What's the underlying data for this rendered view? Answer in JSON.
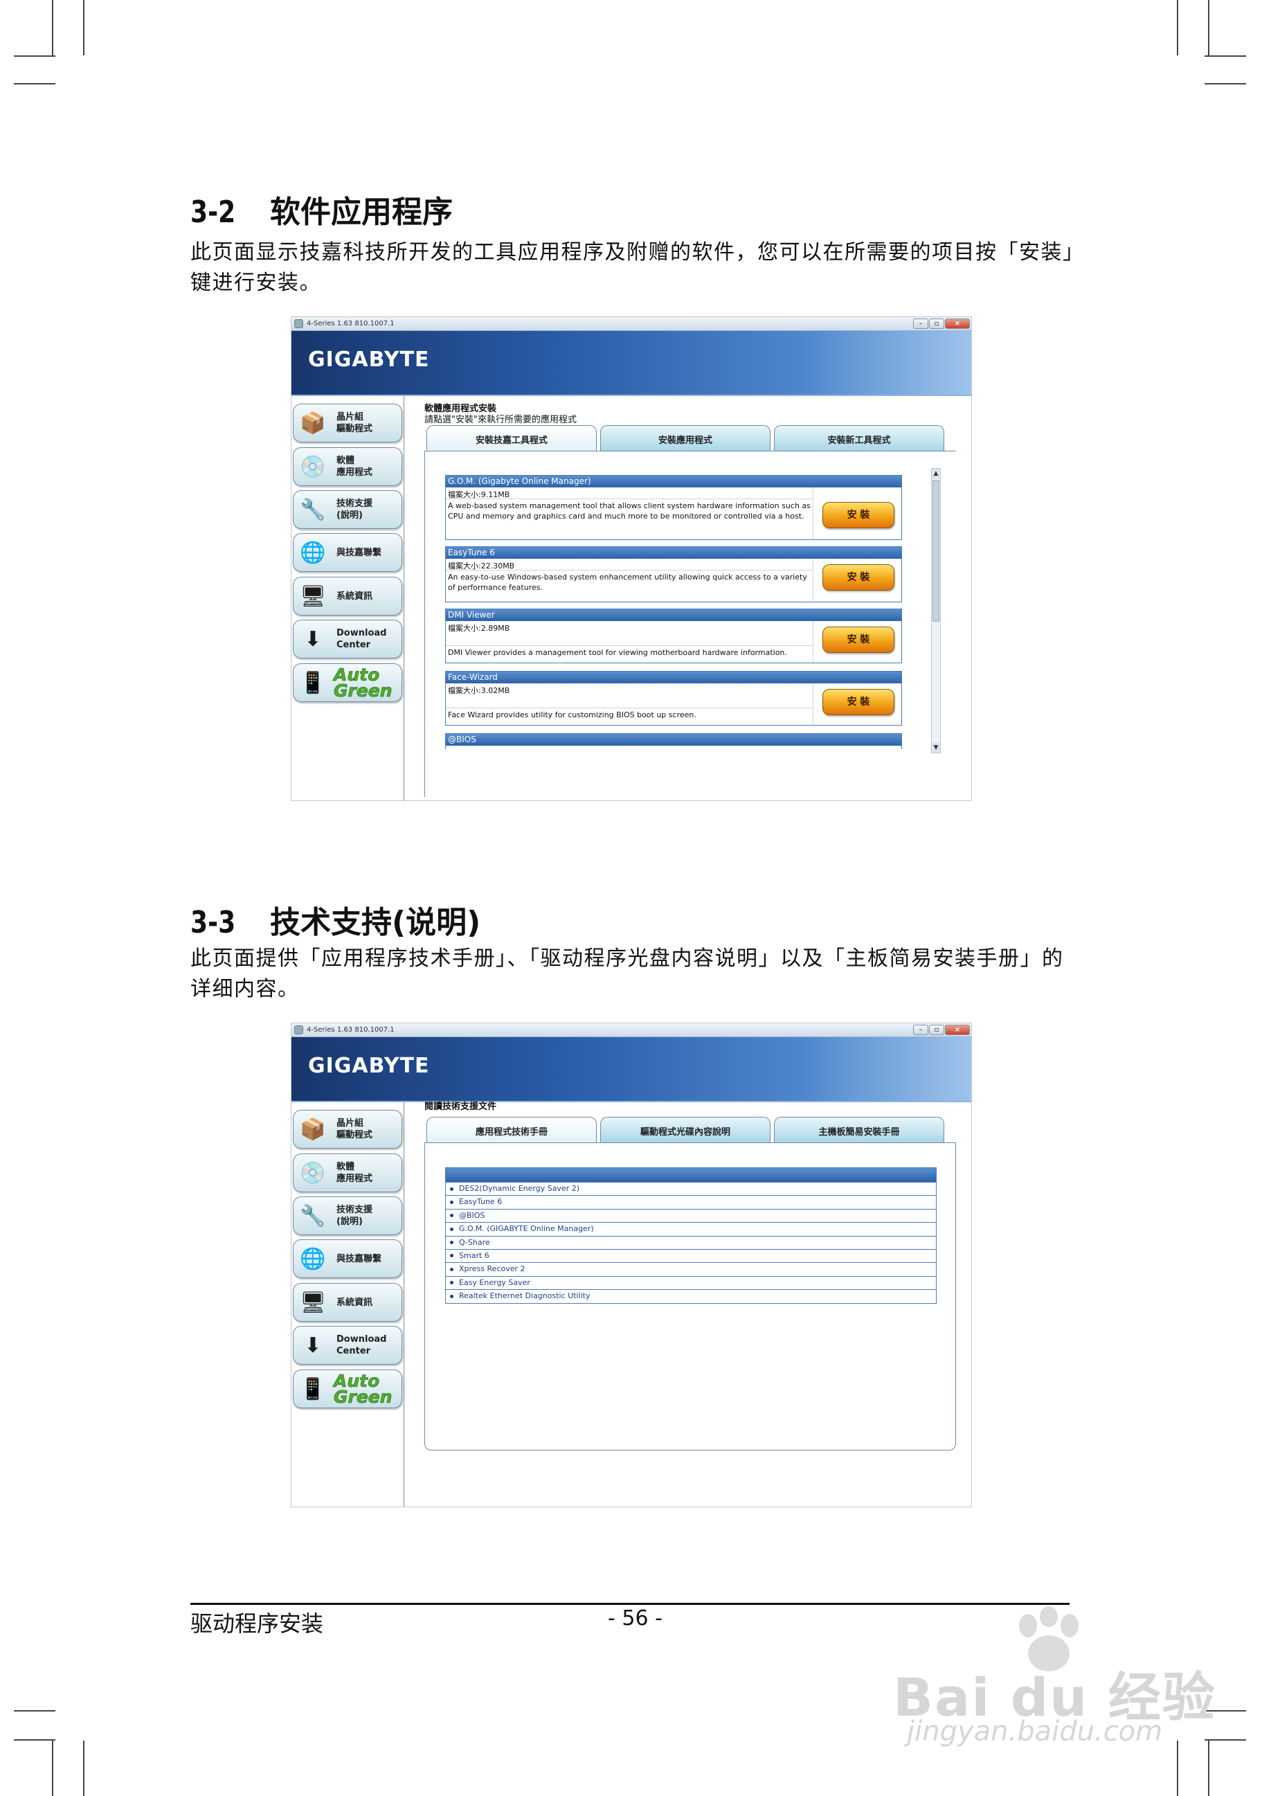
{
  "sections": [
    {
      "number": "3-2",
      "title": "软件应用程序",
      "paragraph": "此页面显示技嘉科技所开发的工具应用程序及附赠的软件，您可以在所需要的项目按「安装」键进行安装。"
    },
    {
      "number": "3-3",
      "title": "技术支持(说明)",
      "paragraph": "此页面提供「应用程序技术手册」、「驱动程序光盘内容说明」以及「主板简易安装手册」的详细内容。"
    }
  ],
  "app": {
    "window_title": "4-Series 1.63 810.1007.1",
    "window_buttons": [
      "–",
      "▫",
      "×"
    ],
    "logo": "GIGABYTE",
    "sidebar": [
      {
        "label": "晶片組\n驅動程式",
        "icon": "chipset-driver-icon",
        "glyph": "📦"
      },
      {
        "label": "軟體\n應用程式",
        "icon": "software-cd-icon",
        "glyph": "💿"
      },
      {
        "label": "技術支援\n(說明)",
        "icon": "tools-icon",
        "glyph": "🔧"
      },
      {
        "label": "與技嘉聯繫",
        "icon": "globe-icon",
        "glyph": "🌐"
      },
      {
        "label": "系統資訊",
        "icon": "system-info-icon",
        "glyph": "🖥"
      },
      {
        "label": "Download\nCenter",
        "icon": "download-center-icon",
        "glyph": "⬇"
      },
      {
        "label": "Auto\nGreen",
        "icon": "auto-green-icon",
        "glyph": "📱"
      }
    ]
  },
  "shot1": {
    "heading": "軟體應用程式安裝",
    "subheading": "請點選\"安裝\"來執行所需要的應用程式",
    "tabs": [
      "安裝技嘉工具程式",
      "安裝應用程式",
      "安裝新工具程式"
    ],
    "install_label": "安 裝",
    "items": [
      {
        "name": "G.O.M. (Gigabyte Online Manager)",
        "size": "檔案大小:9.11MB",
        "desc": "A web-based system management tool that allows client system hardware information such as CPU and memory and graphics card and much more to be monitored or controlled via a host."
      },
      {
        "name": "EasyTune 6",
        "size": "檔案大小:22.30MB",
        "desc": "An easy-to-use Windows-based system enhancement utility allowing quick access to a variety of performance features."
      },
      {
        "name": "DMI Viewer",
        "size": "檔案大小:2.89MB",
        "desc": "DMI Viewer provides a management tool for viewing motherboard hardware information."
      },
      {
        "name": "Face-Wizard",
        "size": "檔案大小:3.02MB",
        "desc": "Face Wizard provides utility for customizing BIOS boot up screen."
      },
      {
        "name": "@BIOS"
      }
    ]
  },
  "shot2": {
    "heading": "閱讀技術支援文件",
    "tabs": [
      "應用程式技術手冊",
      "驅動程式光碟內容說明",
      "主機板簡易安裝手冊"
    ],
    "docs": [
      "DES2(Dynamic Energy Saver 2)",
      "EasyTune 6",
      "@BIOS",
      "G.O.M. (GIGABYTE Online Manager)",
      "Q-Share",
      "Smart 6",
      "Xpress Recover 2",
      "Easy Energy Saver",
      "Realtek Ethernet Diagnostic Utility"
    ]
  },
  "footer": {
    "chapter": "驱动程序安装",
    "page": "- 56 -"
  },
  "watermark": {
    "brand": "Bai du 经验",
    "url": "jingyan.baidu.com"
  },
  "colors": {
    "banner": "#2a5ca8",
    "item_header": "#2c62a8",
    "install_button": "#f3a51a",
    "auto_green": "#4caf2a"
  }
}
